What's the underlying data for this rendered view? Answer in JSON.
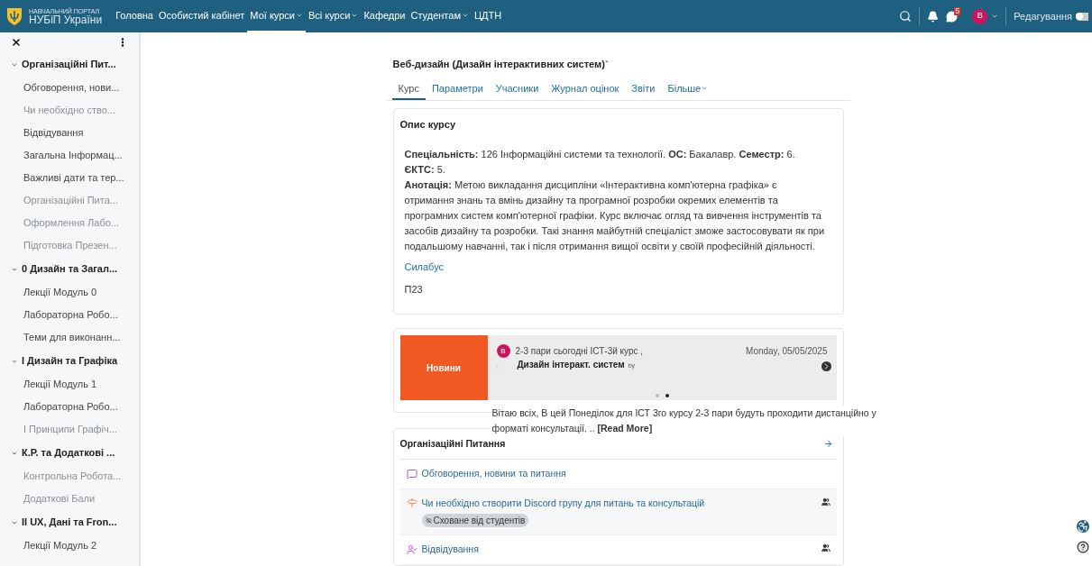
{
  "header": {
    "logo_top": "НАВЧАЛЬНИЙ ПОРТАЛ",
    "logo_bottom": "НУБіП України",
    "nav": [
      {
        "label": "Головна",
        "selected": false,
        "dropdown": false
      },
      {
        "label": "Особистий кабінет",
        "selected": false,
        "dropdown": false
      },
      {
        "label": "Мої курси",
        "selected": true,
        "dropdown": true
      },
      {
        "label": "Всі курси",
        "selected": false,
        "dropdown": true
      },
      {
        "label": "Кафедри",
        "selected": false,
        "dropdown": false
      },
      {
        "label": "Студентам",
        "selected": false,
        "dropdown": true
      },
      {
        "label": "ЦДТН",
        "selected": false,
        "dropdown": false
      }
    ],
    "message_count": "5",
    "avatar": "В",
    "edit_label": "Редагування",
    "edit_on": false
  },
  "sidebar": {
    "sections": [
      {
        "title": "Організаційні Пит...",
        "expanded": true,
        "children": [
          {
            "label": "Обговорення, нови...",
            "dimmed": false
          },
          {
            "label": "Чи необхідно ство...",
            "dimmed": true
          },
          {
            "label": "Відвідування",
            "dimmed": false
          },
          {
            "label": "Загальна Інформац...",
            "dimmed": false
          },
          {
            "label": "Важливі дати та тер...",
            "dimmed": false
          },
          {
            "label": "Організаційні Пита...",
            "dimmed": true
          },
          {
            "label": "Оформлення Лабо...",
            "dimmed": true
          },
          {
            "label": "Підготовка Презен...",
            "dimmed": true
          }
        ]
      },
      {
        "title": "0 Дизайн та Загал...",
        "expanded": true,
        "children": [
          {
            "label": "Лекції Модуль 0",
            "dimmed": false
          },
          {
            "label": "Лабораторна Робо...",
            "dimmed": false
          },
          {
            "label": "Теми для виконанн...",
            "dimmed": false
          }
        ]
      },
      {
        "title": "I Дизайн та Графіка",
        "expanded": true,
        "children": [
          {
            "label": "Лекції Модуль 1",
            "dimmed": false
          },
          {
            "label": "Лабораторна Робо...",
            "dimmed": false
          },
          {
            "label": "I Принципи Графіч...",
            "dimmed": true
          }
        ]
      },
      {
        "title": "К.Р. та Додаткові ...",
        "expanded": true,
        "children": [
          {
            "label": "Контрольна Робота...",
            "dimmed": true
          },
          {
            "label": "Додаткові Бали",
            "dimmed": true
          }
        ]
      },
      {
        "title": "II UX, Дані та Fron...",
        "expanded": true,
        "children": [
          {
            "label": "Лекції Модуль 2",
            "dimmed": false
          }
        ]
      }
    ]
  },
  "course": {
    "title": "Веб-дизайн (Дизайн інтерактивних систем)`",
    "tabs": [
      {
        "label": "Курс",
        "selected": true,
        "dropdown": false
      },
      {
        "label": "Параметри",
        "selected": false,
        "dropdown": false
      },
      {
        "label": "Учасники",
        "selected": false,
        "dropdown": false
      },
      {
        "label": "Журнал оцінок",
        "selected": false,
        "dropdown": false
      },
      {
        "label": "Звіти",
        "selected": false,
        "dropdown": false
      },
      {
        "label": "Більше",
        "selected": false,
        "dropdown": true
      }
    ]
  },
  "description": {
    "title": "Опис курсу",
    "paragraphs": [
      "**Спеціальність:** 126 Інформаційні системи та технології. **ОС:** Бакалавр. **Семестр:** 6. **ЄКТС:** 5.",
      "**Анотація:** Метою викладання дисципліни «Інтерактивна комп'ютерна графіка» є отримання знань та вмінь дизайну та програмної розробки окремих елементів та програмних систем комп'ютерної графіки. Курс включає огляд та вивчення інструментів та засобів дизайну та розробки. Такі знання майбутній спеціаліст зможе застосовувати як при подальшому навчанні, так і після отримання вищої освіти у своїй професійній діяльності."
    ],
    "link": "Силабус",
    "code": "П23"
  },
  "news": {
    "label": "Новини",
    "avatar": "В",
    "title": "2-3 пари сьогодні ІСТ-3й курс ,",
    "date": "Monday, 05/05/2025",
    "course": "Дизайн інтеракт. систем",
    "by": "by",
    "dots": [
      {
        "selected": false
      },
      {
        "selected": true
      }
    ],
    "excerpt": "Вітаю всіх,  В цей Понеділок для ІСТ 3го курсу 2-3 пари будуть проходити дистанційно у форматі консультації. .. **[Read More]**"
  },
  "section": {
    "title": "Організаційні Питання",
    "activities": [
      {
        "kind": "forum",
        "label": "Обговорення, новини та питання",
        "groups": false
      },
      {
        "kind": "url",
        "label": "Чи необхідно створити Discord групу для питань та консультацій",
        "badge": "Сховане від студентів",
        "groups": true
      },
      {
        "kind": "attendance",
        "label": "Відвідування",
        "groups": true
      }
    ]
  }
}
